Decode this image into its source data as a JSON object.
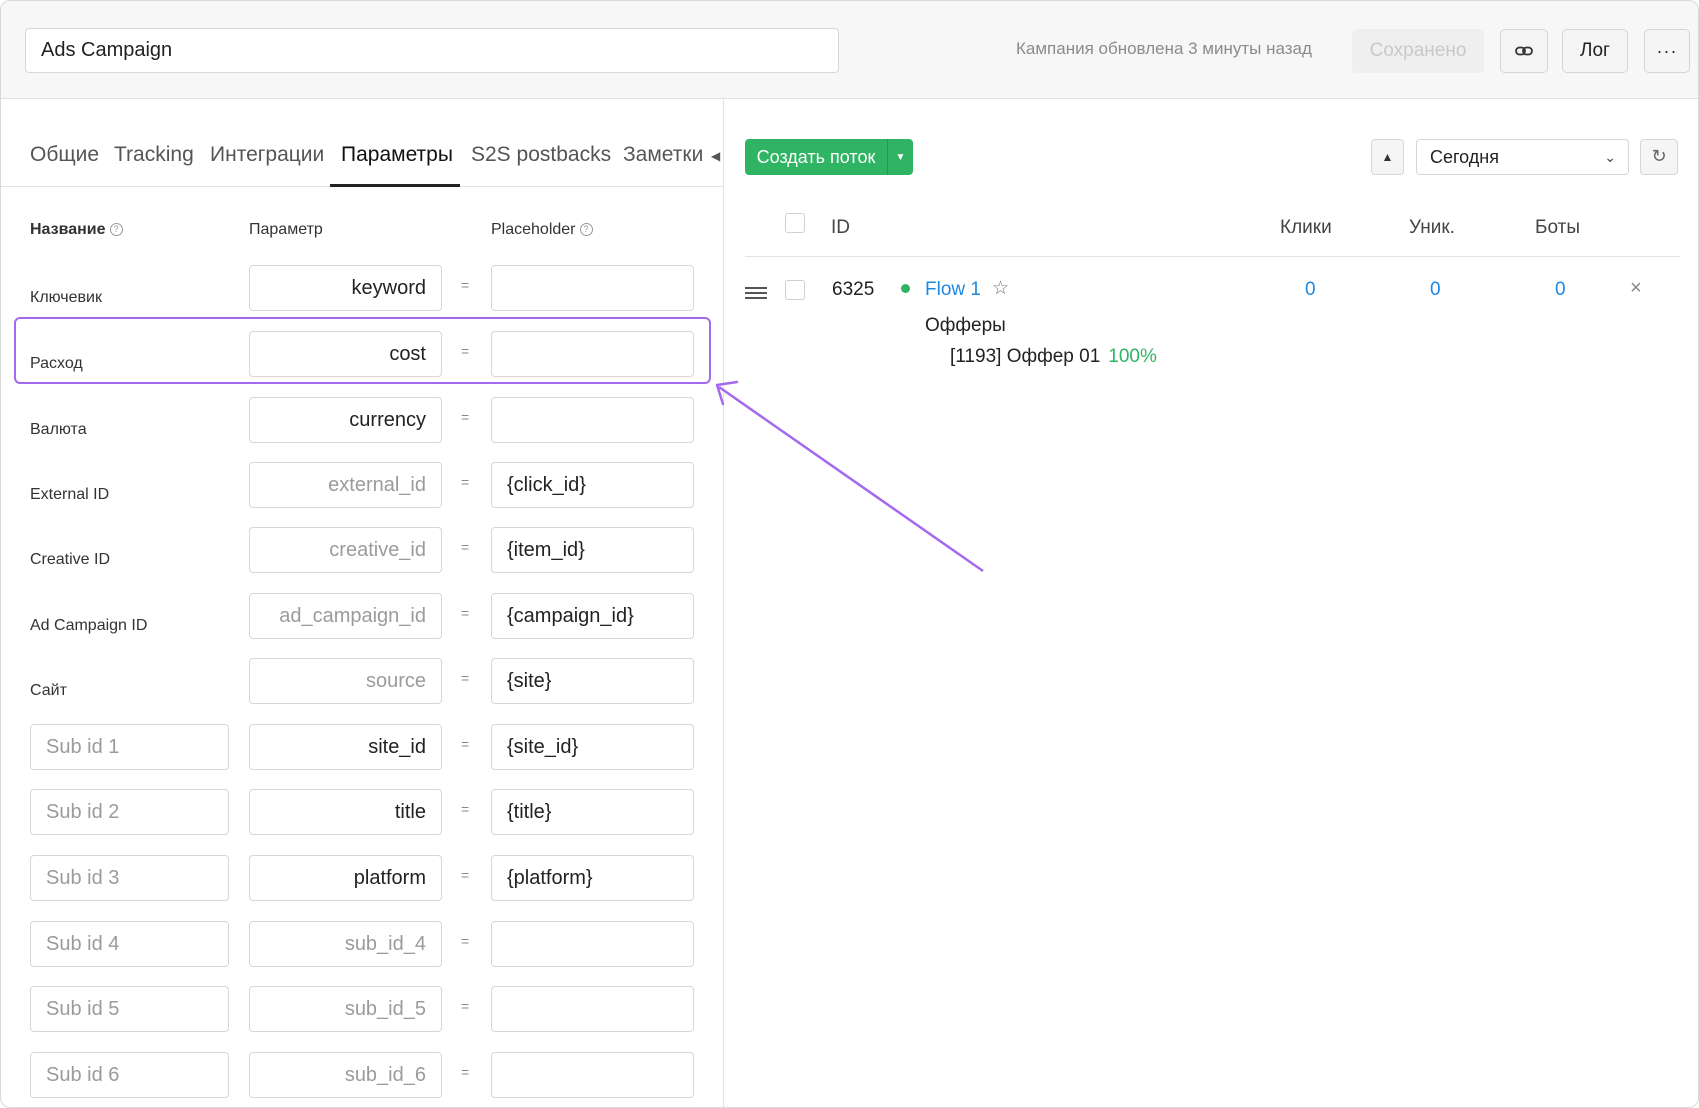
{
  "header": {
    "campaign_name": "Ads Campaign",
    "updated_text": "Кампания обновлена 3 минуты назад",
    "saved_label": "Сохранено",
    "log_label": "Лог",
    "more_label": "···"
  },
  "tabs": [
    "Общие",
    "Tracking",
    "Интеграции",
    "Параметры",
    "S2S postbacks",
    "Заметки"
  ],
  "active_tab": "Параметры",
  "columns": {
    "name": "Название",
    "param": "Параметр",
    "placeholder": "Placeholder"
  },
  "rows": [
    {
      "label": "Ключевик",
      "param": "keyword",
      "param_is_placeholder": false,
      "placeholder": ""
    },
    {
      "label": "Расход",
      "param": "cost",
      "param_is_placeholder": false,
      "placeholder": ""
    },
    {
      "label": "Валюта",
      "param": "currency",
      "param_is_placeholder": false,
      "placeholder": ""
    },
    {
      "label": "External ID",
      "param": "external_id",
      "param_is_placeholder": true,
      "placeholder": "{click_id}"
    },
    {
      "label": "Creative ID",
      "param": "creative_id",
      "param_is_placeholder": true,
      "placeholder": "{item_id}"
    },
    {
      "label": "Ad Campaign ID",
      "param": "ad_campaign_id",
      "param_is_placeholder": true,
      "placeholder": "{campaign_id}"
    },
    {
      "label": "Сайт",
      "param": "source",
      "param_is_placeholder": true,
      "placeholder": "{site}"
    },
    {
      "sub_id": "Sub id 1",
      "param": "site_id",
      "param_is_placeholder": false,
      "placeholder": "{site_id}"
    },
    {
      "sub_id": "Sub id 2",
      "param": "title",
      "param_is_placeholder": false,
      "placeholder": "{title}"
    },
    {
      "sub_id": "Sub id 3",
      "param": "platform",
      "param_is_placeholder": false,
      "placeholder": "{platform}"
    },
    {
      "sub_id": "Sub id 4",
      "param": "sub_id_4",
      "param_is_placeholder": true,
      "placeholder": ""
    },
    {
      "sub_id": "Sub id 5",
      "param": "sub_id_5",
      "param_is_placeholder": true,
      "placeholder": ""
    },
    {
      "sub_id": "Sub id 6",
      "param": "sub_id_6",
      "param_is_placeholder": true,
      "placeholder": ""
    }
  ],
  "equals_sign": "=",
  "flows_panel": {
    "create_label": "Создать поток",
    "period": "Сегодня",
    "table_headers": {
      "id": "ID",
      "clicks": "Клики",
      "unique": "Уник.",
      "bots": "Боты"
    },
    "flow": {
      "id": "6325",
      "name": "Flow 1",
      "clicks": "0",
      "unique": "0",
      "bots": "0",
      "offers_title": "Офферы",
      "offer_name": "[1193] Оффер 01",
      "offer_share": "100%"
    }
  },
  "colors": {
    "accent_green": "#2fb463",
    "link_blue": "#1e88e5",
    "highlight_purple": "#a469ef"
  },
  "icons": {
    "link": "link-icon",
    "more": "more-dots-icon",
    "refresh": "refresh-icon",
    "drag": "drag-handle-icon",
    "star": "star-icon",
    "close": "close-icon",
    "help": "question-icon"
  }
}
